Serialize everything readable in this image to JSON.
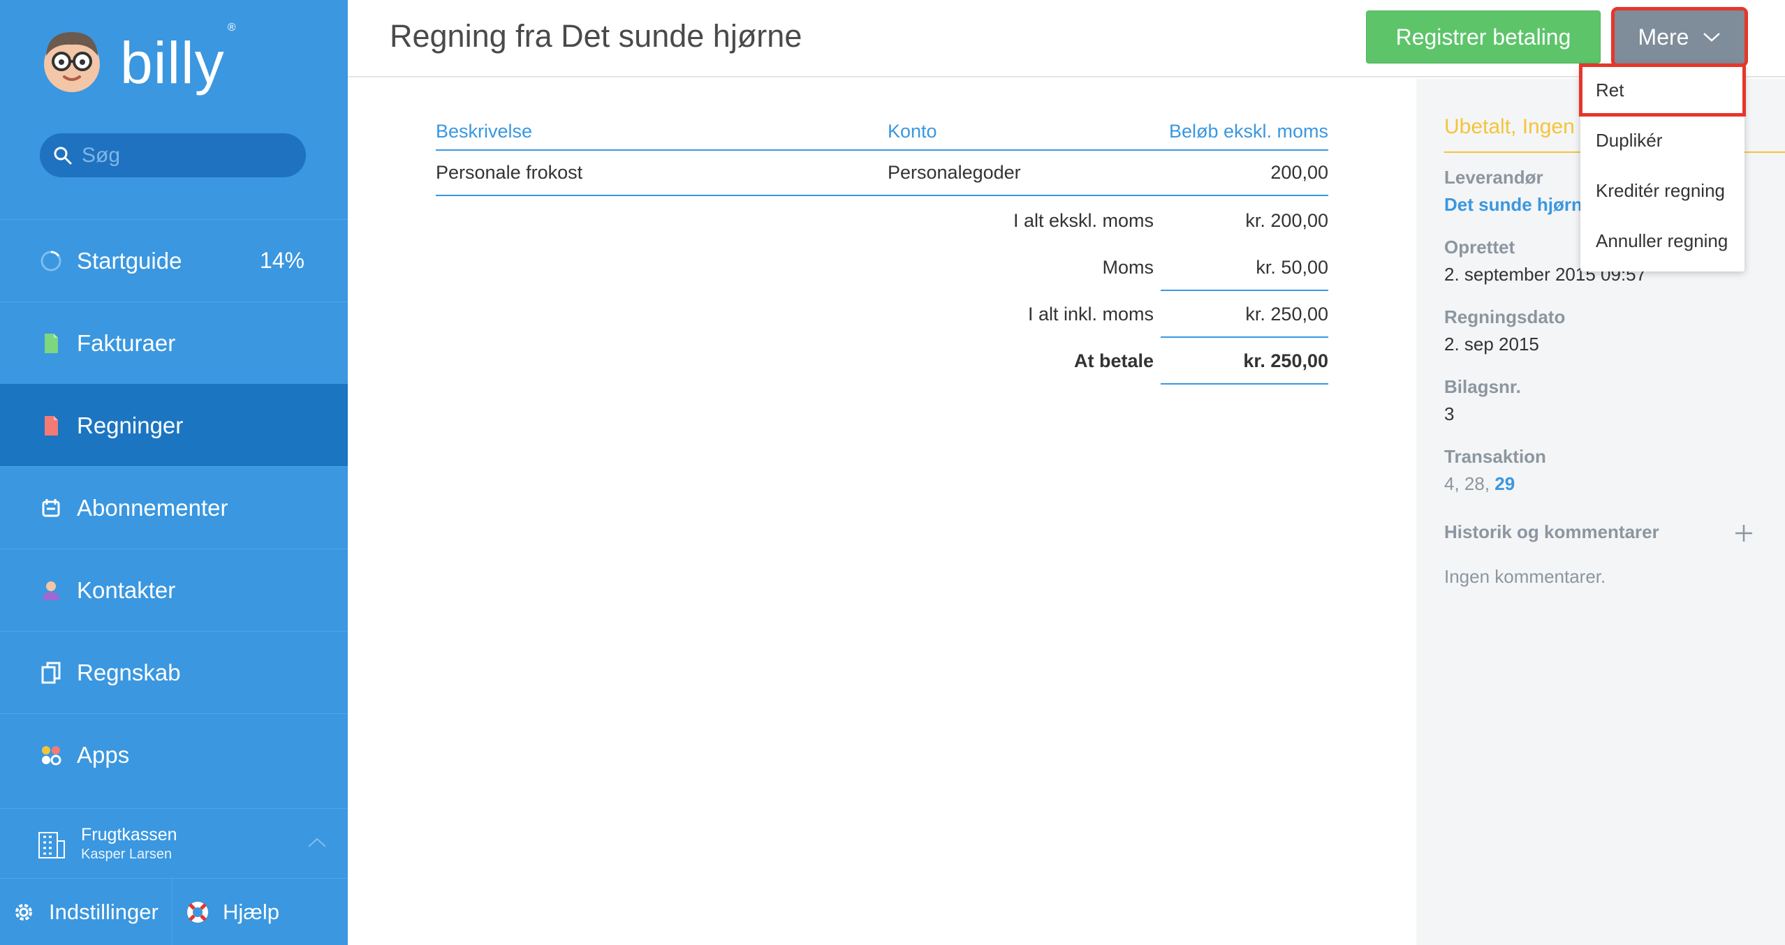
{
  "sidebar": {
    "logo_text": "billy",
    "logo_reg": "®",
    "search_placeholder": "Søg",
    "items": [
      {
        "label": "Startguide",
        "pct": "14%"
      },
      {
        "label": "Fakturaer"
      },
      {
        "label": "Regninger",
        "active": true
      },
      {
        "label": "Abonnementer"
      },
      {
        "label": "Kontakter"
      },
      {
        "label": "Regnskab"
      },
      {
        "label": "Apps"
      }
    ],
    "company": {
      "name": "Frugtkassen",
      "user": "Kasper Larsen"
    },
    "settings_label": "Indstillinger",
    "help_label": "Hjælp"
  },
  "header": {
    "title": "Regning fra Det sunde hjørne",
    "register_label": "Registrer betaling",
    "more_label": "Mere"
  },
  "table": {
    "headers": {
      "description": "Beskrivelse",
      "account": "Konto",
      "amount": "Beløb ekskl. moms"
    },
    "rows": [
      {
        "description": "Personale frokost",
        "account": "Personalegoder",
        "amount": "200,00"
      }
    ],
    "totals": [
      {
        "label": "I alt ekskl. moms",
        "value": "kr. 200,00"
      },
      {
        "label": "Moms",
        "value": "kr. 50,00"
      },
      {
        "label": "I alt inkl. moms",
        "value": "kr. 250,00"
      },
      {
        "label": "At betale",
        "value": "kr. 250,00"
      }
    ]
  },
  "info": {
    "status": "Ubetalt, Ingen",
    "supplier_label": "Leverandør",
    "supplier_value": "Det sunde hjørne",
    "created_label": "Oprettet",
    "created_value": "2. september 2015 09:57",
    "bill_date_label": "Regningsdato",
    "bill_date_value": "2. sep 2015",
    "voucher_label": "Bilagsnr.",
    "voucher_value": "3",
    "transaction_label": "Transaktion",
    "transaction_muted": "4, 28, ",
    "transaction_link": "29",
    "history_label": "Historik og kommentarer",
    "no_comments": "Ingen kommentarer."
  },
  "dropdown": {
    "items": [
      "Ret",
      "Duplikér",
      "Kreditér regning",
      "Annuller regning"
    ]
  },
  "colors": {
    "sidebar_bg": "#3a97e0",
    "sidebar_active": "#1c75c1",
    "register_green": "#5dc46a",
    "more_gray": "#7f8c99",
    "highlight_red": "#e5362b",
    "status_yellow": "#f5c43a",
    "accent_blue": "#3a97e0"
  }
}
